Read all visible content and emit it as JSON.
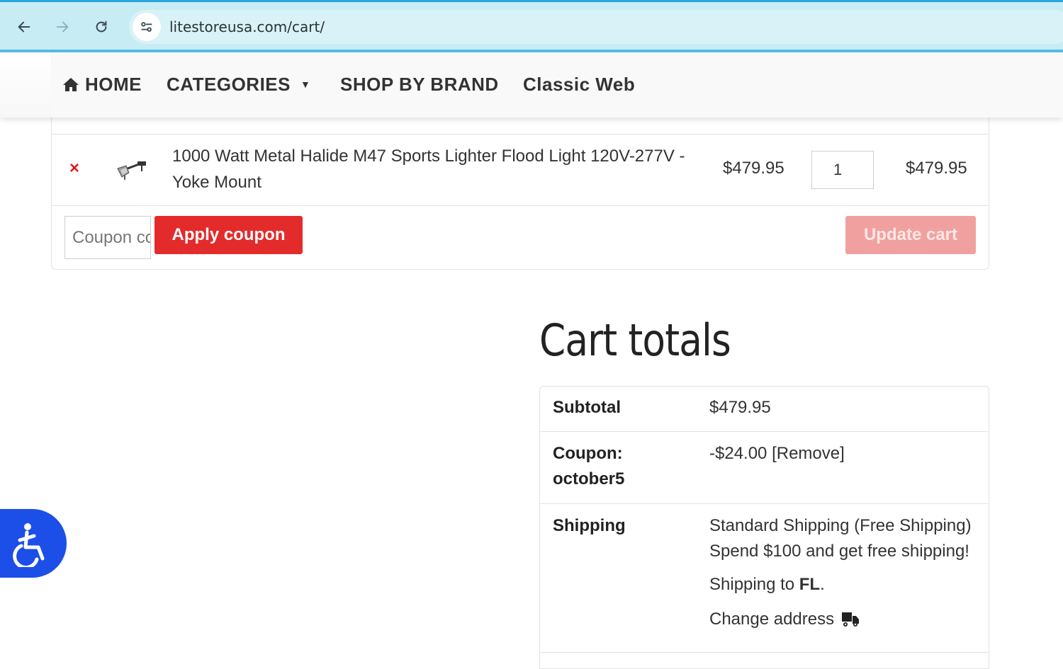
{
  "browser": {
    "url": "litestoreusa.com/cart/",
    "back_icon": "arrow-left-icon",
    "forward_icon": "arrow-right-icon",
    "reload_icon": "reload-icon",
    "site_info_icon": "tune-icon"
  },
  "nav": {
    "home": "HOME",
    "categories": "CATEGORIES",
    "shop_by_brand": "SHOP BY BRAND",
    "classic_web": "Classic Web"
  },
  "cart": {
    "item": {
      "name_line1": "1000 Watt Metal Halide M47 Sports Lighter Flood Light 120V-277V -",
      "name_line2": "Yoke Mount",
      "price": "$479.95",
      "quantity": "1",
      "subtotal": "$479.95",
      "remove_symbol": "×"
    },
    "coupon_placeholder": "Coupon code",
    "apply_label": "Apply coupon",
    "update_label": "Update cart"
  },
  "totals": {
    "title": "Cart totals",
    "subtotal_label": "Subtotal",
    "subtotal_value": "$479.95",
    "coupon_label_line1": "Coupon:",
    "coupon_label_line2": "october5",
    "coupon_value": "-$24.00",
    "coupon_remove": "[Remove]",
    "shipping_label": "Shipping",
    "shipping_method": "Standard Shipping (Free Shipping)",
    "shipping_promo": "Spend $100 and get free shipping!",
    "shipping_to_prefix": "Shipping to ",
    "shipping_to_state": "FL",
    "shipping_to_suffix": ".",
    "change_address": "Change address"
  },
  "colors": {
    "accent_red": "#e42b2b",
    "remove_red": "#e0161b",
    "update_disabled": "#f0a19f",
    "a11y_blue": "#1c4fe8"
  }
}
